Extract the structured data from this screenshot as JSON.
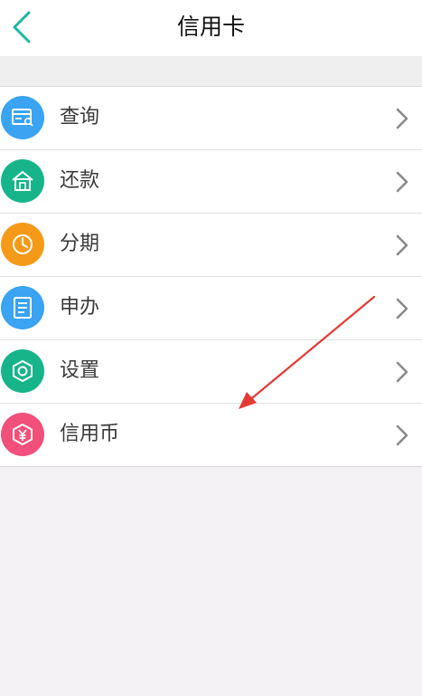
{
  "header": {
    "title": "信用卡",
    "back_icon": "chevron-left-icon",
    "accent": "#1fb5a3"
  },
  "menu": {
    "items": [
      {
        "label": "查询",
        "icon": "card-search-icon",
        "color": "#3aa3f2"
      },
      {
        "label": "还款",
        "icon": "house-icon",
        "color": "#17b48a"
      },
      {
        "label": "分期",
        "icon": "clock-icon",
        "color": "#f49a18"
      },
      {
        "label": "申办",
        "icon": "document-icon",
        "color": "#3aa3f2"
      },
      {
        "label": "设置",
        "icon": "hexagon-settings-icon",
        "color": "#17b48a"
      },
      {
        "label": "信用币",
        "icon": "yuan-coin-icon",
        "color": "#f0507a"
      }
    ],
    "chevron_icon": "chevron-right-icon"
  },
  "annotation": {
    "icon": "red-arrow-icon",
    "color": "#e53935"
  }
}
